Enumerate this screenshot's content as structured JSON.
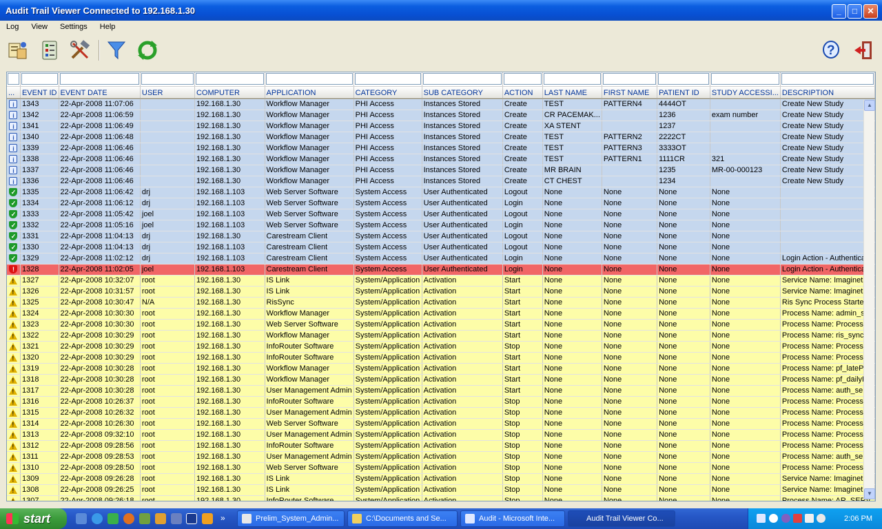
{
  "window": {
    "title": "Audit Trail Viewer Connected to 192.168.1.30"
  },
  "menu": [
    "Log",
    "View",
    "Settings",
    "Help"
  ],
  "toolbar": {
    "items": [
      "log-viewer-icon",
      "report-icon",
      "settings-tools-icon",
      "filter-icon",
      "refresh-icon",
      "help-icon",
      "exit-icon"
    ]
  },
  "colors": {
    "info_row": "#c5d7ee",
    "success_row": "#c5d7ee",
    "error_row": "#f16666",
    "warning_row": "#fdfda8",
    "header_text": "#00339a"
  },
  "grid": {
    "columns": [
      "...",
      "EVENT ID",
      "EVENT DATE",
      "USER",
      "COMPUTER",
      "APPLICATION",
      "CATEGORY",
      "SUB CATEGORY",
      "ACTION",
      "LAST NAME",
      "FIRST NAME",
      "PATIENT ID",
      "STUDY ACCESSI...",
      "DESCRIPTION"
    ],
    "rows": [
      {
        "type": "info",
        "cells": [
          "1343",
          "22-Apr-2008 11:07:06",
          "",
          "192.168.1.30",
          "Workflow Manager",
          "PHI Access",
          "Instances Stored",
          "Create",
          "TEST",
          "PATTERN4",
          "4444OT",
          "",
          "Create New Study"
        ]
      },
      {
        "type": "info",
        "cells": [
          "1342",
          "22-Apr-2008 11:06:59",
          "",
          "192.168.1.30",
          "Workflow Manager",
          "PHI Access",
          "Instances Stored",
          "Create",
          "CR PACEMAK...",
          "",
          "1236",
          "exam number",
          "Create New Study"
        ]
      },
      {
        "type": "info",
        "cells": [
          "1341",
          "22-Apr-2008 11:06:49",
          "",
          "192.168.1.30",
          "Workflow Manager",
          "PHI Access",
          "Instances Stored",
          "Create",
          "XA STENT",
          "",
          "1237",
          "",
          "Create New Study"
        ]
      },
      {
        "type": "info",
        "cells": [
          "1340",
          "22-Apr-2008 11:06:48",
          "",
          "192.168.1.30",
          "Workflow Manager",
          "PHI Access",
          "Instances Stored",
          "Create",
          "TEST",
          "PATTERN2",
          "2222CT",
          "",
          "Create New Study"
        ]
      },
      {
        "type": "info",
        "cells": [
          "1339",
          "22-Apr-2008 11:06:46",
          "",
          "192.168.1.30",
          "Workflow Manager",
          "PHI Access",
          "Instances Stored",
          "Create",
          "TEST",
          "PATTERN3",
          "3333OT",
          "",
          "Create New Study"
        ]
      },
      {
        "type": "info",
        "cells": [
          "1338",
          "22-Apr-2008 11:06:46",
          "",
          "192.168.1.30",
          "Workflow Manager",
          "PHI Access",
          "Instances Stored",
          "Create",
          "TEST",
          "PATTERN1",
          "1111CR",
          "321",
          "Create New Study"
        ]
      },
      {
        "type": "info",
        "cells": [
          "1337",
          "22-Apr-2008 11:06:46",
          "",
          "192.168.1.30",
          "Workflow Manager",
          "PHI Access",
          "Instances Stored",
          "Create",
          "MR BRAIN",
          "",
          "1235",
          "MR-00-000123",
          "Create New Study"
        ]
      },
      {
        "type": "info",
        "cells": [
          "1336",
          "22-Apr-2008 11:06:46",
          "",
          "192.168.1.30",
          "Workflow Manager",
          "PHI Access",
          "Instances Stored",
          "Create",
          "CT CHEST",
          "",
          "1234",
          "",
          "Create New Study"
        ]
      },
      {
        "type": "success",
        "cells": [
          "1335",
          "22-Apr-2008 11:06:42",
          "drj",
          "192.168.1.103",
          "Web Server Software",
          "System Access",
          "User Authenticated",
          "Logout",
          "None",
          "None",
          "None",
          "None",
          ""
        ]
      },
      {
        "type": "success",
        "cells": [
          "1334",
          "22-Apr-2008 11:06:12",
          "drj",
          "192.168.1.103",
          "Web Server Software",
          "System Access",
          "User Authenticated",
          "Login",
          "None",
          "None",
          "None",
          "None",
          ""
        ]
      },
      {
        "type": "success",
        "cells": [
          "1333",
          "22-Apr-2008 11:05:42",
          "joel",
          "192.168.1.103",
          "Web Server Software",
          "System Access",
          "User Authenticated",
          "Logout",
          "None",
          "None",
          "None",
          "None",
          ""
        ]
      },
      {
        "type": "success",
        "cells": [
          "1332",
          "22-Apr-2008 11:05:16",
          "joel",
          "192.168.1.103",
          "Web Server Software",
          "System Access",
          "User Authenticated",
          "Login",
          "None",
          "None",
          "None",
          "None",
          ""
        ]
      },
      {
        "type": "success",
        "cells": [
          "1331",
          "22-Apr-2008 11:04:13",
          "drj",
          "192.168.1.30",
          "Carestream Client",
          "System Access",
          "User Authenticated",
          "Logout",
          "None",
          "None",
          "None",
          "None",
          ""
        ]
      },
      {
        "type": "success",
        "cells": [
          "1330",
          "22-Apr-2008 11:04:13",
          "drj",
          "192.168.1.103",
          "Carestream Client",
          "System Access",
          "User Authenticated",
          "Logout",
          "None",
          "None",
          "None",
          "None",
          ""
        ]
      },
      {
        "type": "success",
        "cells": [
          "1329",
          "22-Apr-2008 11:02:12",
          "drj",
          "192.168.1.103",
          "Carestream Client",
          "System Access",
          "User Authenticated",
          "Login",
          "None",
          "None",
          "None",
          "None",
          "Login Action - Authenticat"
        ]
      },
      {
        "type": "error",
        "cells": [
          "1328",
          "22-Apr-2008 11:02:05",
          "joel",
          "192.168.1.103",
          "Carestream Client",
          "System Access",
          "User Authenticated",
          "Login",
          "None",
          "None",
          "None",
          "None",
          "Login Action - Authenticat"
        ]
      },
      {
        "type": "warning",
        "cells": [
          "1327",
          "22-Apr-2008 10:32:07",
          "root",
          "192.168.1.30",
          "IS Link",
          "System/Application",
          "Activation",
          "Start",
          "None",
          "None",
          "None",
          "None",
          "Service Name: Imaginet M"
        ]
      },
      {
        "type": "warning",
        "cells": [
          "1326",
          "22-Apr-2008 10:31:57",
          "root",
          "192.168.1.30",
          "IS Link",
          "System/Application",
          "Activation",
          "Start",
          "None",
          "None",
          "None",
          "None",
          "Service Name: Imaginet M"
        ]
      },
      {
        "type": "warning",
        "cells": [
          "1325",
          "22-Apr-2008 10:30:47",
          "N/A",
          "192.168.1.30",
          "RisSync",
          "System/Application",
          "Activation",
          "Start",
          "None",
          "None",
          "None",
          "None",
          "Ris Sync Process Started"
        ]
      },
      {
        "type": "warning",
        "cells": [
          "1324",
          "22-Apr-2008 10:30:30",
          "root",
          "192.168.1.30",
          "Workflow Manager",
          "System/Application",
          "Activation",
          "Start",
          "None",
          "None",
          "None",
          "None",
          "Process Name: admin_ser"
        ]
      },
      {
        "type": "warning",
        "cells": [
          "1323",
          "22-Apr-2008 10:30:30",
          "root",
          "192.168.1.30",
          "Web Server Software",
          "System/Application",
          "Activation",
          "Start",
          "None",
          "None",
          "None",
          "None",
          "Process Name: Process ID"
        ]
      },
      {
        "type": "warning",
        "cells": [
          "1322",
          "22-Apr-2008 10:30:29",
          "root",
          "192.168.1.30",
          "Workflow Manager",
          "System/Application",
          "Activation",
          "Start",
          "None",
          "None",
          "None",
          "None",
          "Process Name: ris_syncP"
        ]
      },
      {
        "type": "warning",
        "cells": [
          "1321",
          "22-Apr-2008 10:30:29",
          "root",
          "192.168.1.30",
          "InfoRouter Software",
          "System/Application",
          "Activation",
          "Stop",
          "None",
          "None",
          "None",
          "None",
          "Process Name: Process ID"
        ]
      },
      {
        "type": "warning",
        "cells": [
          "1320",
          "22-Apr-2008 10:30:29",
          "root",
          "192.168.1.30",
          "InfoRouter Software",
          "System/Application",
          "Activation",
          "Start",
          "None",
          "None",
          "None",
          "None",
          "Process Name: Process ID"
        ]
      },
      {
        "type": "warning",
        "cells": [
          "1319",
          "22-Apr-2008 10:30:28",
          "root",
          "192.168.1.30",
          "Workflow Manager",
          "System/Application",
          "Activation",
          "Start",
          "None",
          "None",
          "None",
          "None",
          "Process Name: pf_latePro"
        ]
      },
      {
        "type": "warning",
        "cells": [
          "1318",
          "22-Apr-2008 10:30:28",
          "root",
          "192.168.1.30",
          "Workflow Manager",
          "System/Application",
          "Activation",
          "Start",
          "None",
          "None",
          "None",
          "None",
          "Process Name: pf_dailyPr"
        ]
      },
      {
        "type": "warning",
        "cells": [
          "1317",
          "22-Apr-2008 10:30:28",
          "root",
          "192.168.1.30",
          "User Management Admin",
          "System/Application",
          "Activation",
          "Start",
          "None",
          "None",
          "None",
          "None",
          "Process Name: auth_serv"
        ]
      },
      {
        "type": "warning",
        "cells": [
          "1316",
          "22-Apr-2008 10:26:37",
          "root",
          "192.168.1.30",
          "InfoRouter Software",
          "System/Application",
          "Activation",
          "Stop",
          "None",
          "None",
          "None",
          "None",
          "Process Name: Process ID"
        ]
      },
      {
        "type": "warning",
        "cells": [
          "1315",
          "22-Apr-2008 10:26:32",
          "root",
          "192.168.1.30",
          "User Management Admin",
          "System/Application",
          "Activation",
          "Stop",
          "None",
          "None",
          "None",
          "None",
          "Process Name: Process ID"
        ]
      },
      {
        "type": "warning",
        "cells": [
          "1314",
          "22-Apr-2008 10:26:30",
          "root",
          "192.168.1.30",
          "Web Server Software",
          "System/Application",
          "Activation",
          "Stop",
          "None",
          "None",
          "None",
          "None",
          "Process Name: Process ID"
        ]
      },
      {
        "type": "warning",
        "cells": [
          "1313",
          "22-Apr-2008 09:32:10",
          "root",
          "192.168.1.30",
          "User Management Admin",
          "System/Application",
          "Activation",
          "Stop",
          "None",
          "None",
          "None",
          "None",
          "Process Name: Process ID"
        ]
      },
      {
        "type": "warning",
        "cells": [
          "1312",
          "22-Apr-2008 09:28:56",
          "root",
          "192.168.1.30",
          "InfoRouter Software",
          "System/Application",
          "Activation",
          "Stop",
          "None",
          "None",
          "None",
          "None",
          "Process Name: Process ID"
        ]
      },
      {
        "type": "warning",
        "cells": [
          "1311",
          "22-Apr-2008 09:28:53",
          "root",
          "192.168.1.30",
          "User Management Admin",
          "System/Application",
          "Activation",
          "Stop",
          "None",
          "None",
          "None",
          "None",
          "Process Name: auth_serv"
        ]
      },
      {
        "type": "warning",
        "cells": [
          "1310",
          "22-Apr-2008 09:28:50",
          "root",
          "192.168.1.30",
          "Web Server Software",
          "System/Application",
          "Activation",
          "Stop",
          "None",
          "None",
          "None",
          "None",
          "Process Name: Process ID"
        ]
      },
      {
        "type": "warning",
        "cells": [
          "1309",
          "22-Apr-2008 09:26:28",
          "root",
          "192.168.1.30",
          "IS Link",
          "System/Application",
          "Activation",
          "Stop",
          "None",
          "None",
          "None",
          "None",
          "Service Name: Imaginet M"
        ]
      },
      {
        "type": "warning",
        "cells": [
          "1308",
          "22-Apr-2008 09:26:25",
          "root",
          "192.168.1.30",
          "IS Link",
          "System/Application",
          "Activation",
          "Stop",
          "None",
          "None",
          "None",
          "None",
          "Service Name: Imaginet M"
        ]
      },
      {
        "type": "warning",
        "cells": [
          "1307",
          "22-Apr-2008 09:26:18",
          "root",
          "192.168.1.30",
          "InfoRouter Software",
          "System/Application",
          "Activation",
          "Stop",
          "None",
          "None",
          "None",
          "None",
          "Process Name: AR_SERV"
        ]
      }
    ]
  },
  "taskbar": {
    "start": "start",
    "tasks": [
      "Prelim_System_Admin...",
      "C:\\Documents and Se...",
      "Audit - Microsoft Inte...",
      "Audit Trail Viewer Co..."
    ],
    "clock": "2:06 PM"
  }
}
